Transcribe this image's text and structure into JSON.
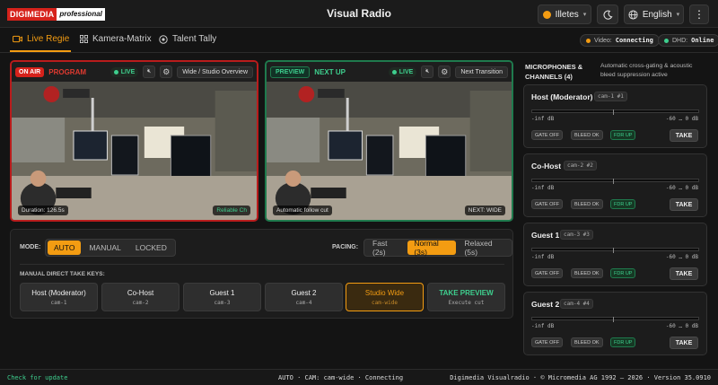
{
  "header": {
    "logo_brand": "DIGIMEDIA",
    "logo_suffix": "professional",
    "title": "Visual Radio",
    "user": "Illetes",
    "language": "English",
    "icons": [
      "moon-icon",
      "globe-icon",
      "more-vert-icon"
    ]
  },
  "tabs": [
    {
      "label": "Live Regie",
      "icon": "camera-icon",
      "active": true
    },
    {
      "label": "Kamera-Matrix",
      "icon": "grid-icon",
      "active": false
    },
    {
      "label": "Talent Tally",
      "icon": "target-icon",
      "active": false
    }
  ],
  "status_pills": {
    "video_label": "Video:",
    "video_value": "Connecting",
    "dhd_label": "DHD:",
    "dhd_value": "Online"
  },
  "program": {
    "tag": "ON AIR",
    "title": "PROGRAM",
    "live": "LIVE",
    "scene_button": "Wide / Studio Overview",
    "duration": "Duration: 126.5s",
    "overlay_right": "Reliable Ch"
  },
  "preview": {
    "tag": "PREVIEW",
    "title": "NEXT UP",
    "live": "LIVE",
    "button": "Next Transition",
    "overlay_left": "Automatic follow cut",
    "overlay_right": "NEXT: WIDE"
  },
  "controls": {
    "mode_label": "MODE:",
    "modes": [
      "AUTO",
      "MANUAL",
      "LOCKED"
    ],
    "mode_selected": "AUTO",
    "pacing_label": "PACING:",
    "pacings": [
      "Fast (2s)",
      "Normal (3s)",
      "Relaxed (5s)"
    ],
    "pacing_selected": "Normal (3s)",
    "keys_label": "MANUAL DIRECT TAKE KEYS:",
    "keys": [
      {
        "label": "Host (Moderator)",
        "sub": "cam-1"
      },
      {
        "label": "Co-Host",
        "sub": "cam-2"
      },
      {
        "label": "Guest 1",
        "sub": "cam-3"
      },
      {
        "label": "Guest 2",
        "sub": "cam-4"
      },
      {
        "label": "Studio Wide",
        "sub": "cam-wide"
      },
      {
        "label": "TAKE PREVIEW",
        "sub": "Execute cut"
      }
    ]
  },
  "sidebar": {
    "title_line1": "MICROPHONES &",
    "title_line2": "CHANNELS (4)",
    "desc_line1": "Automatic cross-gating & acoustic",
    "desc_line2": "bleed suppression active",
    "channels": [
      {
        "name": "Host (Moderator)",
        "cam": "cam-1 #1",
        "level": "-inf dB",
        "range": "-60 … 0 dB",
        "gate": "GATE OFF",
        "bleed": "BLEED OK",
        "fdr": "FDR UP",
        "take": "TAKE"
      },
      {
        "name": "Co-Host",
        "cam": "cam-2 #2",
        "level": "-inf dB",
        "range": "-60 … 0 dB",
        "gate": "GATE OFF",
        "bleed": "BLEED OK",
        "fdr": "FDR UP",
        "take": "TAKE"
      },
      {
        "name": "Guest 1",
        "cam": "cam-3 #3",
        "level": "-inf dB",
        "range": "-60 … 0 dB",
        "gate": "GATE OFF",
        "bleed": "BLEED OK",
        "fdr": "FDR UP",
        "take": "TAKE"
      },
      {
        "name": "Guest 2",
        "cam": "cam-4 #4",
        "level": "-inf dB",
        "range": "-60 … 0 dB",
        "gate": "GATE OFF",
        "bleed": "BLEED OK",
        "fdr": "FDR UP",
        "take": "TAKE"
      }
    ]
  },
  "statusbar": {
    "update": "Check for update",
    "center": "AUTO · CAM: cam-wide · Connecting",
    "right": "Digimedia Visualradio · © Micromedia AG 1992 – 2026 · Version 35.0910"
  },
  "colors": {
    "accent": "#f39c12",
    "onair": "#d6221b",
    "live": "#3ecf8e"
  }
}
